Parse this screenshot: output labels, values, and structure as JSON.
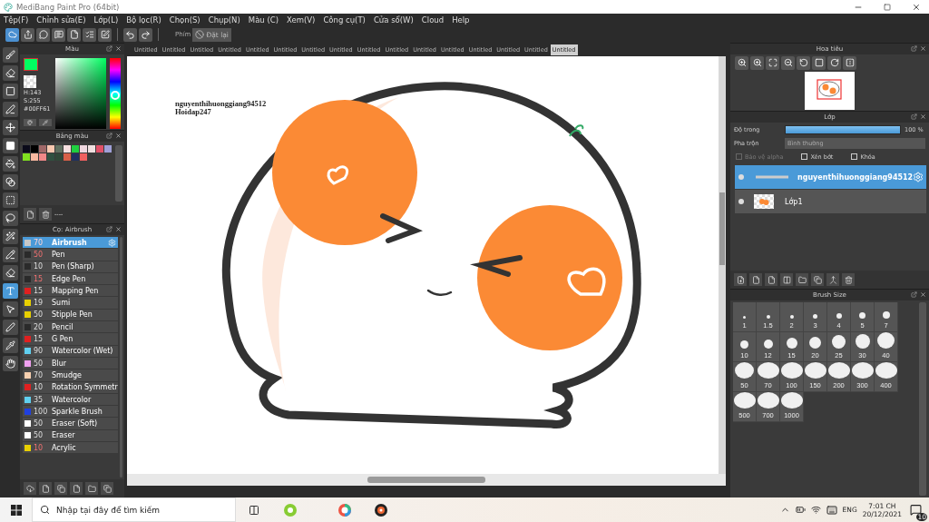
{
  "window": {
    "title": "MediBang Paint Pro (64bit)"
  },
  "menu": [
    "Tệp(F)",
    "Chỉnh sửa(E)",
    "Lớp(L)",
    "Bộ lọc(R)",
    "Chọn(S)",
    "Chụp(N)",
    "Màu (C)",
    "Xem(V)",
    "Công cụ(T)",
    "Cửa sổ(W)",
    "Cloud",
    "Help"
  ],
  "toolbar": {
    "key_label": "Phím",
    "reset_button": "Đặt lại"
  },
  "tools": [
    {
      "kind": "brush",
      "selected": false
    },
    {
      "kind": "eraser",
      "selected": false
    },
    {
      "kind": "shape",
      "selected": false
    },
    {
      "kind": "line",
      "selected": false
    },
    {
      "kind": "move",
      "selected": false
    },
    {
      "kind": "fill",
      "selected": false
    },
    {
      "kind": "bucket",
      "selected": false
    },
    {
      "kind": "gradient",
      "selected": false
    },
    {
      "kind": "select",
      "selected": false
    },
    {
      "kind": "lasso",
      "selected": false
    },
    {
      "kind": "wand",
      "selected": false
    },
    {
      "kind": "selectpen",
      "selected": false
    },
    {
      "kind": "selecteraser",
      "selected": false
    },
    {
      "kind": "text",
      "selected": true
    },
    {
      "kind": "pointer",
      "selected": false
    },
    {
      "kind": "pen",
      "selected": false
    },
    {
      "kind": "dropper",
      "selected": false
    },
    {
      "kind": "hand",
      "selected": false
    }
  ],
  "color_panel": {
    "title": "Màu",
    "h": "H:143",
    "s": "S:255",
    "hex": "#00FF61",
    "hue_slider": {
      "level": 0.52
    }
  },
  "palette_panel": {
    "title": "Bảng màu",
    "footer": "----",
    "colors": [
      {
        "color": "#0a0a1a"
      },
      {
        "color": "#000000"
      },
      {
        "color": "#a06868"
      },
      {
        "color": "#f8c8b0"
      },
      {
        "color": "#607060"
      },
      {
        "color": "#f8e0e0"
      },
      {
        "color": "#20d040"
      },
      {
        "color": "#f0d8e0"
      },
      {
        "color": "#f0e0e0"
      },
      {
        "color": "#e05068"
      },
      {
        "color": "#a0a0d8"
      },
      {
        "color": "#80e020"
      },
      {
        "color": "#f8b8a0"
      },
      {
        "color": "#f08888"
      },
      {
        "color": "#305040"
      },
      {
        "color": "#304838"
      },
      {
        "color": "#d86048"
      },
      {
        "color": "#203060"
      },
      {
        "color": "#f06060"
      }
    ]
  },
  "brush_panel": {
    "title": "Cọ: Airbrush",
    "brushes": [
      {
        "size": "70",
        "name": "Airbrush",
        "color": "#c8c8c8",
        "modified": true,
        "selected": true
      },
      {
        "size": "50",
        "name": "Pen",
        "color": "#2a2a2a",
        "modified": true,
        "selected": false
      },
      {
        "size": "10",
        "name": "Pen (Sharp)",
        "color": "#2a2a2a",
        "modified": false,
        "selected": false
      },
      {
        "size": "15",
        "name": "Edge Pen",
        "color": "#2a2a2a",
        "modified": true,
        "selected": false
      },
      {
        "size": "15",
        "name": "Mapping Pen",
        "color": "#e02020",
        "modified": false,
        "selected": false
      },
      {
        "size": "19",
        "name": "Sumi",
        "color": "#e8d000",
        "modified": false,
        "selected": false
      },
      {
        "size": "50",
        "name": "Stipple Pen",
        "color": "#e8d000",
        "modified": false,
        "selected": false
      },
      {
        "size": "20",
        "name": "Pencil",
        "color": "#2a2a2a",
        "modified": false,
        "selected": false
      },
      {
        "size": "15",
        "name": "G Pen",
        "color": "#e02020",
        "modified": false,
        "selected": false
      },
      {
        "size": "90",
        "name": "Watercolor (Wet)",
        "color": "#60d0f0",
        "modified": false,
        "selected": false
      },
      {
        "size": "50",
        "name": "Blur",
        "color": "#f0a0f0",
        "modified": false,
        "selected": false
      },
      {
        "size": "70",
        "name": "Smudge",
        "color": "#f8d0b0",
        "modified": false,
        "selected": false
      },
      {
        "size": "10",
        "name": "Rotation Symmetr",
        "color": "#e02020",
        "modified": false,
        "selected": false
      },
      {
        "size": "35",
        "name": "Watercolor",
        "color": "#60d0f0",
        "modified": false,
        "selected": false
      },
      {
        "size": "100",
        "name": "Sparkle Brush",
        "color": "#2040e0",
        "modified": false,
        "selected": false
      },
      {
        "size": "50",
        "name": "Eraser (Soft)",
        "color": "#ffffff",
        "modified": false,
        "selected": false
      },
      {
        "size": "50",
        "name": "Eraser",
        "color": "#ffffff",
        "modified": false,
        "selected": false
      },
      {
        "size": "10",
        "name": "Acrylic",
        "color": "#e8d000",
        "modified": true,
        "selected": false
      }
    ]
  },
  "document_tabs": [
    {
      "label": "Untitled",
      "selected": false
    },
    {
      "label": "Untitled",
      "selected": false
    },
    {
      "label": "Untitled",
      "selected": false
    },
    {
      "label": "Untitled",
      "selected": false
    },
    {
      "label": "Untitled",
      "selected": false
    },
    {
      "label": "Untitled",
      "selected": false
    },
    {
      "label": "Untitled",
      "selected": false
    },
    {
      "label": "Untitled",
      "selected": false
    },
    {
      "label": "Untitled",
      "selected": false
    },
    {
      "label": "Untitled",
      "selected": false
    },
    {
      "label": "Untitled",
      "selected": false
    },
    {
      "label": "Untitled",
      "selected": false
    },
    {
      "label": "Untitled",
      "selected": false
    },
    {
      "label": "Untitled",
      "selected": false
    },
    {
      "label": "Untitled",
      "selected": false
    },
    {
      "label": "Untitled",
      "selected": true
    }
  ],
  "canvas": {
    "text_lines": [
      "nguyenthihuonggiang94512",
      "Hoidap247"
    ]
  },
  "navigator": {
    "title": "Hoa tiêu"
  },
  "layer_panel": {
    "title": "Lớp",
    "opacity_label": "Độ trong",
    "opacity": {
      "level": 1.0,
      "reading": "100 %"
    },
    "blend_label": "Pha trộn",
    "blend_value": "Bình thường",
    "options": [
      {
        "label": "Bảo vệ alpha",
        "checked": false,
        "disabled": true
      },
      {
        "label": "Xén bớt",
        "checked": false,
        "disabled": false
      },
      {
        "label": "Khóa",
        "checked": false,
        "disabled": false
      }
    ],
    "layers": [
      {
        "name": "nguyenthihuonggiang94512",
        "kind": "text",
        "selected": true
      },
      {
        "name": "Lớp1",
        "kind": "image",
        "selected": false
      }
    ]
  },
  "brush_size_panel": {
    "title": "Brush Size",
    "sizes": [
      "1",
      "1.5",
      "2",
      "3",
      "4",
      "5",
      "7",
      "10",
      "12",
      "15",
      "20",
      "25",
      "30",
      "40",
      "50",
      "70",
      "100",
      "150",
      "200",
      "300",
      "400",
      "500",
      "700",
      "1000"
    ]
  },
  "taskbar": {
    "search_placeholder": "Nhập tại đây để tìm kiếm",
    "language": "ENG",
    "time": "7:01 CH",
    "date": "20/12/2021",
    "notifications": "10"
  }
}
